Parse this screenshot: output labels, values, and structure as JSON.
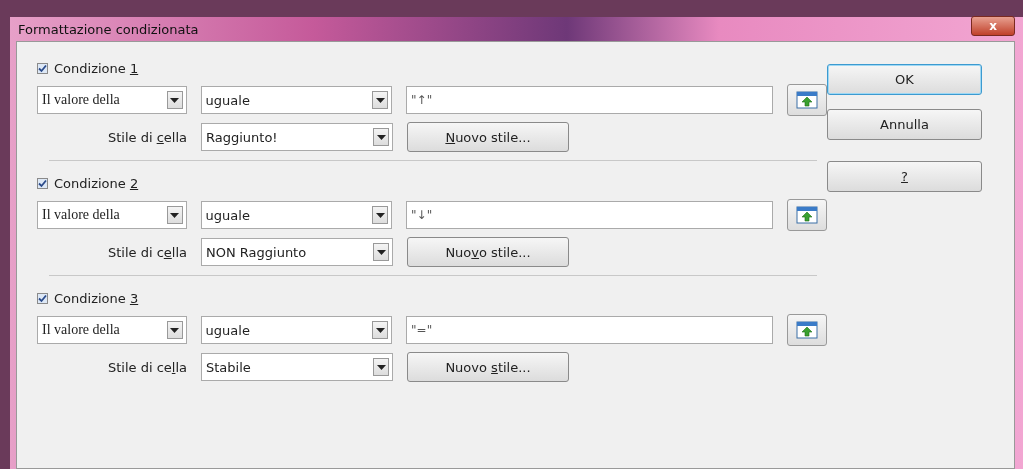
{
  "window": {
    "title": "Formattazione condizionata",
    "close": "x"
  },
  "conditions": [
    {
      "label": {
        "pre": "Condizione ",
        "key": "1"
      },
      "checked": true,
      "source": "Il valore della",
      "operator": "uguale",
      "value": "\"↑\"",
      "style_label": {
        "pre": "Stile di ",
        "key": "c",
        "post": "ella"
      },
      "style": "Raggiunto!",
      "new_style": {
        "key": "N",
        "post": "uovo stile..."
      }
    },
    {
      "label": {
        "pre": "Condizione ",
        "key": "2"
      },
      "checked": true,
      "source": "Il valore della",
      "operator": "uguale",
      "value": "\"↓\"",
      "style_label": {
        "pre": "Stile di c",
        "key": "e",
        "post": "lla"
      },
      "style": "NON Raggiunto",
      "new_style": {
        "pre": "Nuo",
        "key": "v",
        "post": "o stile..."
      }
    },
    {
      "label": {
        "pre": "Condizione ",
        "key": "3"
      },
      "checked": true,
      "source": "Il valore della",
      "operator": "uguale",
      "value": "\"=\"",
      "style_label": {
        "pre": "Stile di ce",
        "key": "l",
        "post": "la"
      },
      "style": "Stabile",
      "new_style": {
        "pre": "Nuovo ",
        "key": "s",
        "post": "tile..."
      }
    }
  ],
  "buttons": [
    {
      "kind": "default",
      "label": {
        "pre": "OK"
      }
    },
    {
      "kind": "normal",
      "label": {
        "pre": "Annulla"
      }
    },
    {
      "kind": "normal",
      "label": {
        "key": "?"
      }
    }
  ]
}
